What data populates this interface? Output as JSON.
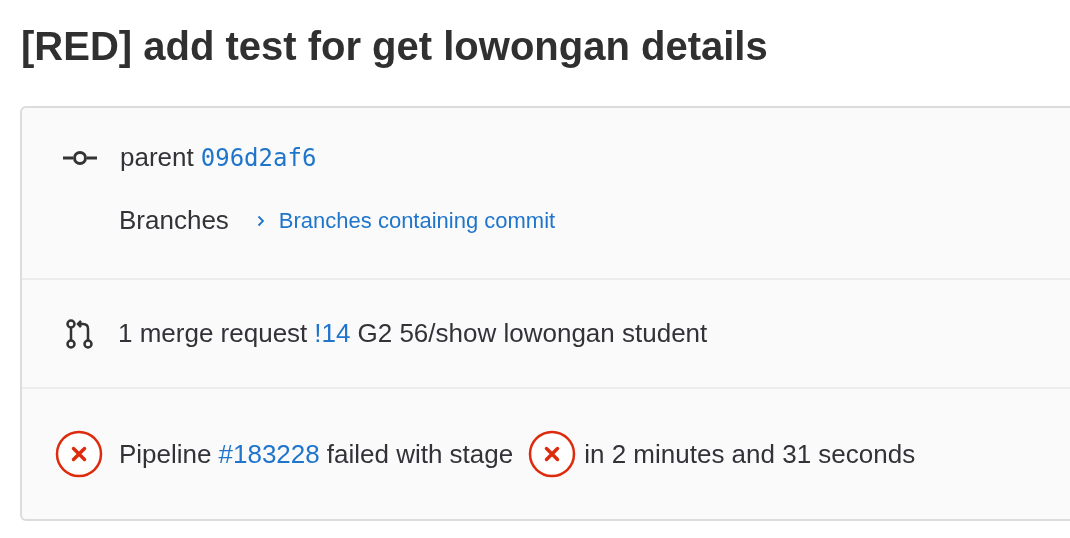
{
  "title": "[RED] add test for get lowongan details",
  "commit": {
    "parent_label": "parent",
    "parent_hash": "096d2af6",
    "branches_label": "Branches",
    "branches_link": "Branches containing commit"
  },
  "merge_requests": {
    "count_text": "1 merge request",
    "link": "!14",
    "title": "G2 56/show lowongan student"
  },
  "pipeline": {
    "failed": true,
    "label": "Pipeline",
    "link": "#183228",
    "text_before_stage": "failed with stage",
    "stage_failed": true,
    "duration": "in 2 minutes and 31 seconds"
  }
}
